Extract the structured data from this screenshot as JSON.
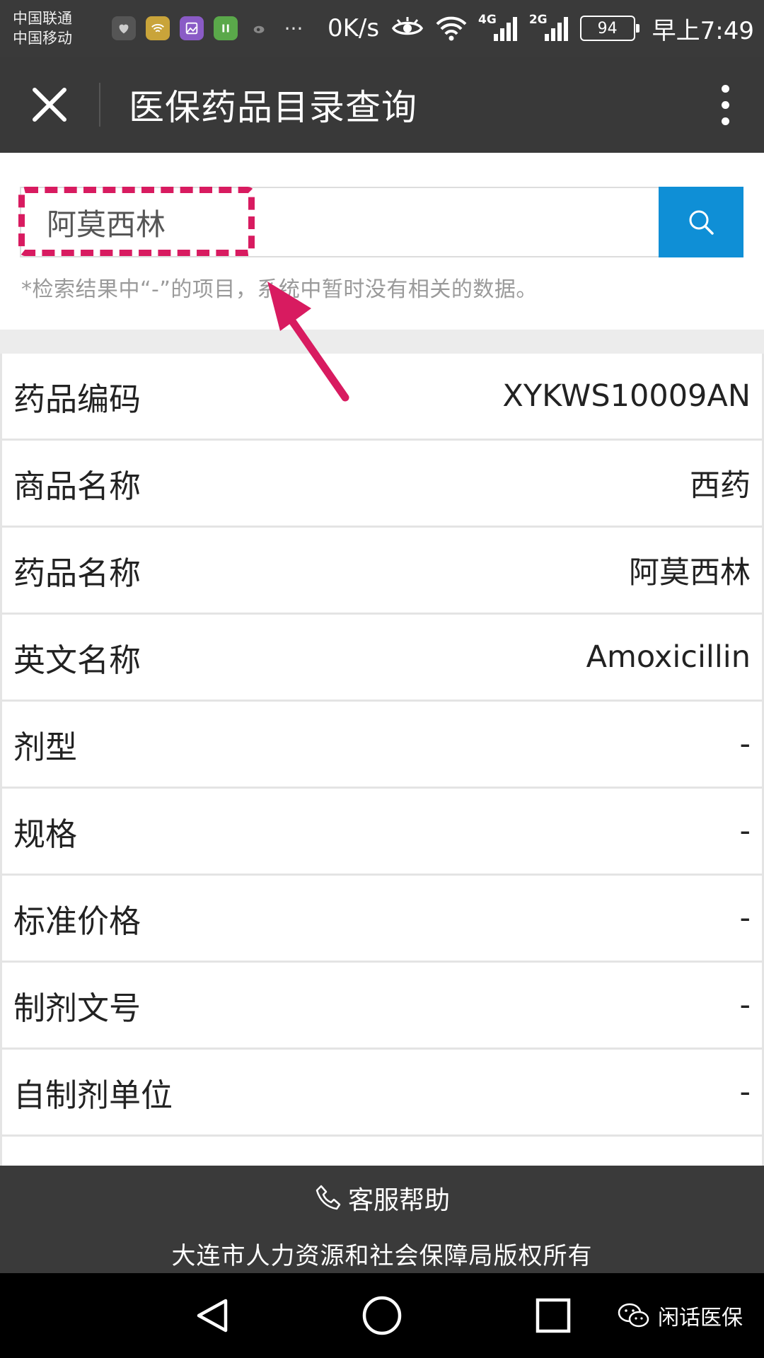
{
  "status_bar": {
    "carrier_1": "中国联通",
    "carrier_2": "中国移动",
    "net_speed": "0K/s",
    "net_4g": "4G",
    "net_2g": "2G",
    "battery": "94",
    "time": "早上7:49"
  },
  "title_bar": {
    "title": "医保药品目录查询"
  },
  "search": {
    "value": "阿莫西林",
    "note": "*检索结果中“-”的项目，系统中暂时没有相关的数据。"
  },
  "details": [
    {
      "label": "药品编码",
      "value": "XYKWS10009AN"
    },
    {
      "label": "商品名称",
      "value": "西药"
    },
    {
      "label": "药品名称",
      "value": "阿莫西林"
    },
    {
      "label": "英文名称",
      "value": "Amoxicillin"
    },
    {
      "label": "剂型",
      "value": "-"
    },
    {
      "label": "规格",
      "value": "-"
    },
    {
      "label": "标准价格",
      "value": "-"
    },
    {
      "label": "制剂文号",
      "value": "-"
    },
    {
      "label": "自制剂单位",
      "value": "-"
    }
  ],
  "footer": {
    "help_label": "客服帮助",
    "copyright": "大连市人力资源和社会保障局版权所有"
  },
  "watermark": {
    "text": "闲话医保"
  },
  "colors": {
    "accent": "#0f8fd6",
    "highlight": "#d81b60",
    "bar": "#3a3a3a"
  }
}
